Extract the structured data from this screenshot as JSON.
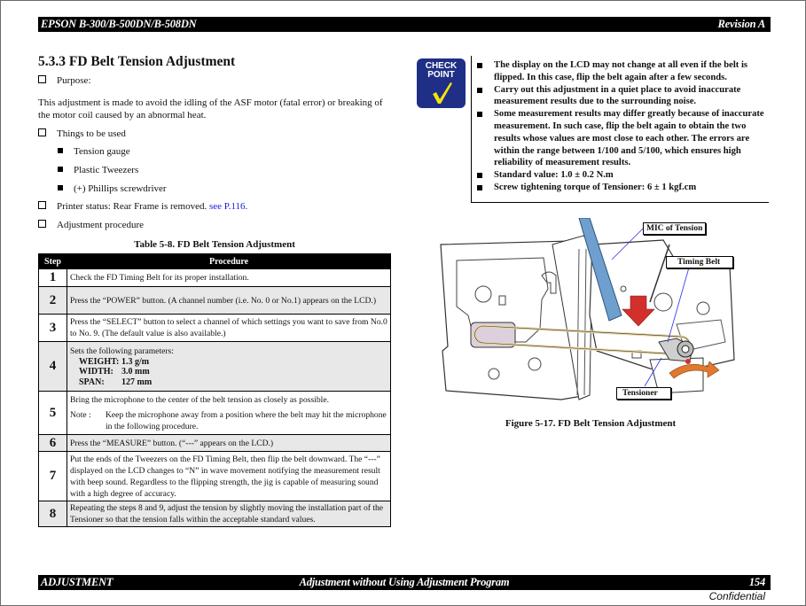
{
  "header": {
    "left": "EPSON B-300/B-500DN/B-508DN",
    "right": "Revision A"
  },
  "section": {
    "number": "5.3.3",
    "title": "FD Belt Tension Adjustment",
    "full": "5.3.3  FD Belt Tension Adjustment"
  },
  "purpose": {
    "label": "Purpose:",
    "text": "This adjustment is made to avoid the idling of the ASF motor (fatal error) or breaking of the motor coil caused by an abnormal heat."
  },
  "things": {
    "label": "Things to be used",
    "items": [
      "Tension gauge",
      "Plastic Tweezers",
      "(+) Phillips screwdriver"
    ]
  },
  "printer_status": {
    "label": "Printer status: Rear Frame is removed.",
    "link": "see P.116."
  },
  "adjustment_procedure": {
    "label": "Adjustment procedure"
  },
  "table": {
    "caption": "Table 5-8.  FD Belt Tension Adjustment",
    "headers": [
      "Step",
      "Procedure"
    ],
    "rows": [
      {
        "step": "1",
        "text": "Check the FD Timing Belt for its proper installation."
      },
      {
        "step": "2",
        "text": "Press the “POWER” button. (A channel number (i.e. No. 0 or No.1) appears on the LCD.)"
      },
      {
        "step": "3",
        "text": "Press the “SELECT” button to select a channel of which settings you want to save from No.0 to No. 9. (The default value is also available.)"
      },
      {
        "step": "4",
        "text": "Sets the following parameters:",
        "params": [
          {
            "key": "WEIGHT:",
            "value": "1.3 g/m"
          },
          {
            "key": "WIDTH:",
            "value": "3.0 mm"
          },
          {
            "key": "SPAN:",
            "value": "127 mm"
          }
        ]
      },
      {
        "step": "5",
        "text": "Bring the microphone to the center of the belt tension as closely as possible.",
        "note_label": "Note  :",
        "note": "Keep the microphone away from a position where the belt may hit the microphone in the following procedure."
      },
      {
        "step": "6",
        "text": "Press the “MEASURE” button. (“---” appears on the LCD.)"
      },
      {
        "step": "7",
        "text": "Put the ends of the Tweezers on the FD Timing Belt, then flip the belt downward. The “---” displayed on the LCD changes to “N” in wave movement notifying the measurement result with beep sound. Regardless to the flipping strength, the jig is capable of measuring sound with a high degree of accuracy."
      },
      {
        "step": "8",
        "text": "Repeating the steps 8 and 9, adjust the tension by slightly moving the installation part of the Tensioner so that the tension falls within the acceptable standard values."
      }
    ]
  },
  "checkpoint": {
    "icon_line1": "CHECK",
    "icon_line2": "POINT",
    "items": [
      "The display on the LCD may not change at all even if the belt is flipped. In this case, flip the belt again after a few seconds.",
      "Carry out this adjustment in a quiet place to avoid inaccurate measurement results due to the surrounding noise.",
      "Some measurement results may differ greatly because of inaccurate measurement. In such case, flip the belt again to obtain the two results whose values are most close to each other. The errors are within the range between 1/100 and 5/100, which ensures high reliability of measurement results.",
      "Standard value: 1.0 ± 0.2 N.m",
      "Screw tightening torque of Tensioner: 6 ± 1 kgf.cm"
    ]
  },
  "figure": {
    "callouts": {
      "mic": "MIC of Tension",
      "belt": "Timing Belt",
      "tensioner": "Tensioner"
    },
    "caption": "Figure 5-17.  FD Belt Tension Adjustment",
    "colors": {
      "mic": "#6f9fcf",
      "arrow_down": "#d3302b",
      "arrow_rotate": "#e0782e",
      "belt": "#e8d7a6",
      "leader": "#2b2bf0"
    }
  },
  "footer": {
    "left": "ADJUSTMENT",
    "center": "Adjustment without Using Adjustment Program",
    "page": "154",
    "confidential": "Confidential"
  }
}
